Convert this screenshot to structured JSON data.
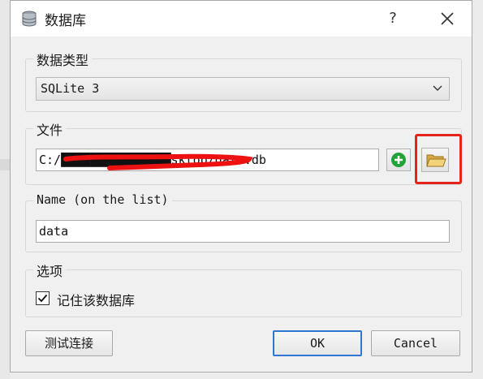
{
  "window": {
    "title": "数据库",
    "help_label": "?"
  },
  "type_group": {
    "label": "数据类型",
    "selected": "SQLite 3"
  },
  "file_group": {
    "label": "文件",
    "path": "C:/███████████████sktop/data.db"
  },
  "name_group": {
    "label": "Name (on the list)",
    "value": "data"
  },
  "options_group": {
    "label": "选项",
    "remember_label": "记住该数据库",
    "remember_checked": true
  },
  "buttons": {
    "test": "测试连接",
    "ok": "OK",
    "cancel": "Cancel"
  },
  "colors": {
    "highlight": "#e4241b",
    "redaction": "#ee1111",
    "default_button_border": "#2f76d2",
    "add_icon": "#22a33a"
  },
  "icons": [
    "database-icon",
    "help-icon",
    "close-icon",
    "chevron-down-icon",
    "add-icon",
    "folder-icon",
    "checkmark-icon"
  ]
}
